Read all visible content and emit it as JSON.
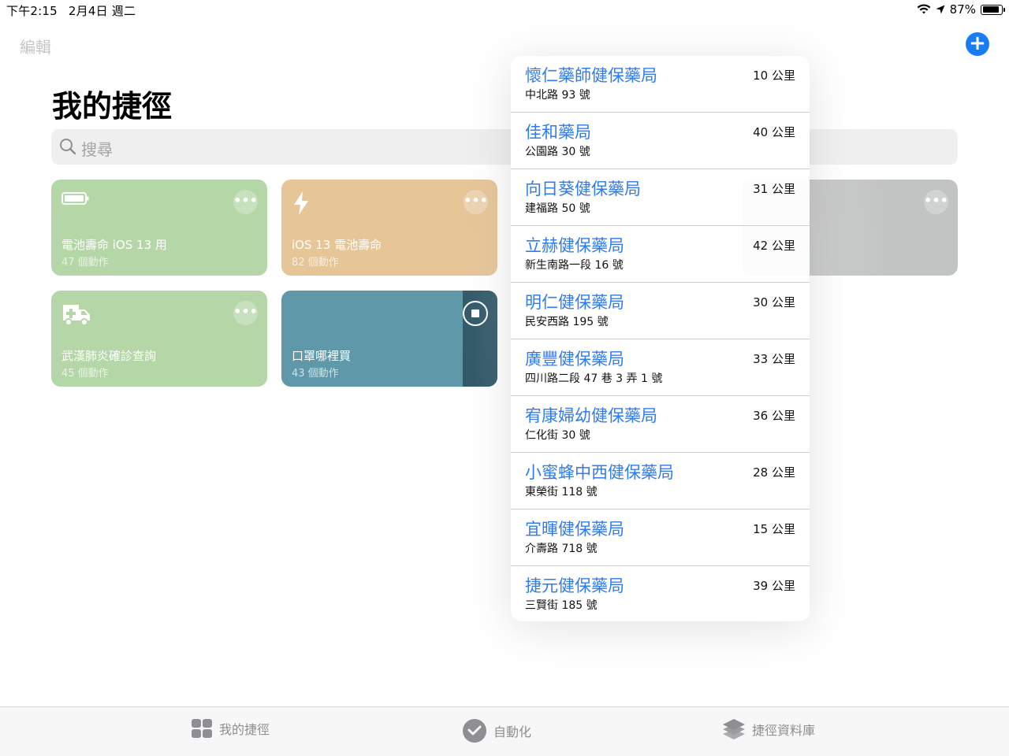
{
  "status_bar": {
    "time": "下午2:15",
    "date": "2月4日 週二",
    "battery_percent": "87%",
    "battery_level": 0.87
  },
  "header": {
    "edit_label": "編輯",
    "title": "我的捷徑",
    "add_icon": "plus-circle-icon"
  },
  "search": {
    "placeholder": "搜尋"
  },
  "shortcuts": [
    {
      "title": "電池壽命 iOS 13 用",
      "subtitle": "47 個動作",
      "color": "#b5d6a7",
      "icon": "battery-icon"
    },
    {
      "title": "iOS 13 電池壽命",
      "subtitle": "82 個動作",
      "color": "#e6c597",
      "icon": "bolt-icon"
    },
    {
      "title": "",
      "subtitle": "",
      "color": "#c2c3c3",
      "icon": ""
    },
    {
      "title": "武漢肺炎確診查詢",
      "subtitle": "45 個動作",
      "color": "#b5d6a7",
      "icon": "ambulance-icon"
    },
    {
      "title": "口罩哪裡買",
      "subtitle": "43 個動作",
      "color": "#5f99a9",
      "icon": "stop-icon"
    }
  ],
  "results": [
    {
      "name": "懷仁藥師健保藥局",
      "address": "中北路 93 號",
      "distance": "10 公里"
    },
    {
      "name": "佳和藥局",
      "address": "公園路 30 號",
      "distance": "40 公里"
    },
    {
      "name": "向日葵健保藥局",
      "address": "建福路 50 號",
      "distance": "31 公里"
    },
    {
      "name": "立赫健保藥局",
      "address": "新生南路一段 16 號",
      "distance": "42 公里"
    },
    {
      "name": "明仁健保藥局",
      "address": "民安西路 195 號",
      "distance": "30 公里"
    },
    {
      "name": "廣豐健保藥局",
      "address": "四川路二段 47 巷 3 弄 1 號",
      "distance": "33 公里"
    },
    {
      "name": "宥康婦幼健保藥局",
      "address": "仁化街 30 號",
      "distance": "36 公里"
    },
    {
      "name": "小蜜蜂中西健保藥局",
      "address": "東榮街 118 號",
      "distance": "28 公里"
    },
    {
      "name": "宜暉健保藥局",
      "address": "介壽路 718 號",
      "distance": "15 公里"
    },
    {
      "name": "捷元健保藥局",
      "address": "三賢街 185 號",
      "distance": "39 公里"
    }
  ],
  "tabs": [
    {
      "label": "我的捷徑",
      "icon": "grid-icon"
    },
    {
      "label": "自動化",
      "icon": "checkmark-circle-icon"
    },
    {
      "label": "捷徑資料庫",
      "icon": "layers-icon"
    }
  ]
}
